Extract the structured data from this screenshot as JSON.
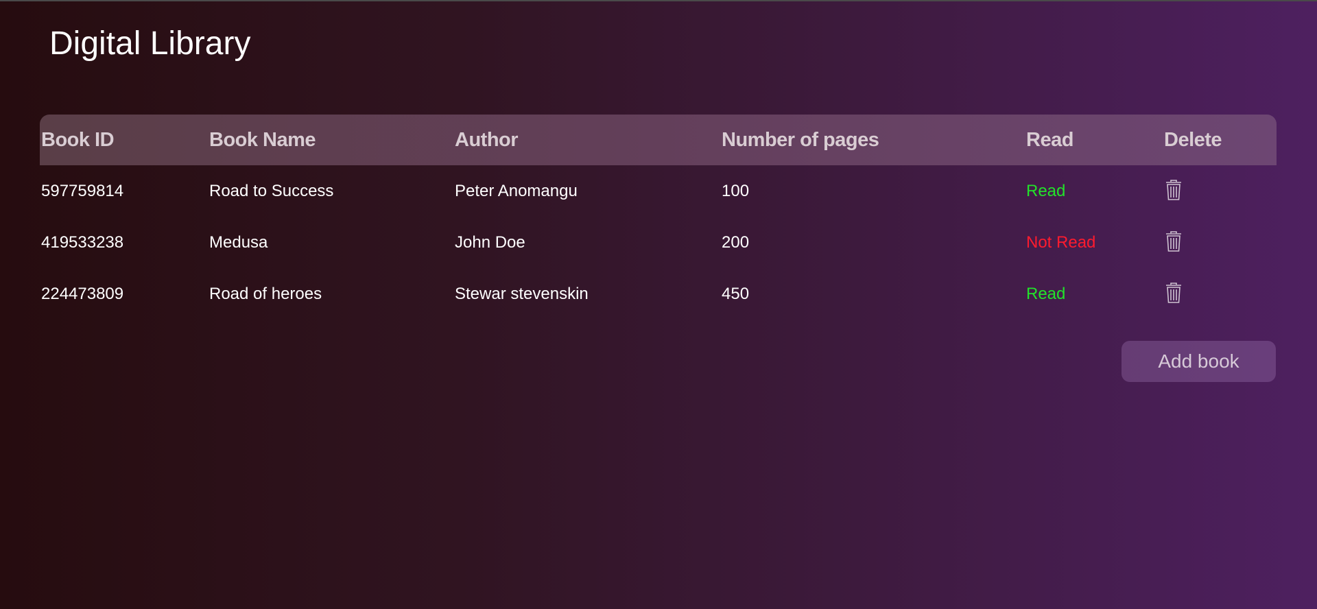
{
  "page": {
    "title": "Digital Library"
  },
  "table": {
    "headers": [
      "Book ID",
      "Book Name",
      "Author",
      "Number of pages",
      "Read",
      "Delete"
    ],
    "rows": [
      {
        "id": "597759814",
        "name": "Road to Success",
        "author": "Peter Anomangu",
        "pages": "100",
        "read": "Read",
        "read_color": "#22e22a",
        "delete_icon": "trash-icon"
      },
      {
        "id": "419533238",
        "name": "Medusa",
        "author": "John Doe",
        "pages": "200",
        "read": "Not Read",
        "read_color": "#ff1b2e",
        "delete_icon": "trash-icon"
      },
      {
        "id": "224473809",
        "name": "Road of heroes",
        "author": "Stewar stevenskin",
        "pages": "450",
        "read": "Read",
        "read_color": "#22e22a",
        "delete_icon": "trash-icon"
      }
    ]
  },
  "actions": {
    "add_book_label": "Add book"
  },
  "colors": {
    "read": "#22e22a",
    "not_read": "#ff1b2e",
    "background_start": "#260c0f",
    "background_end": "#4e2060"
  }
}
